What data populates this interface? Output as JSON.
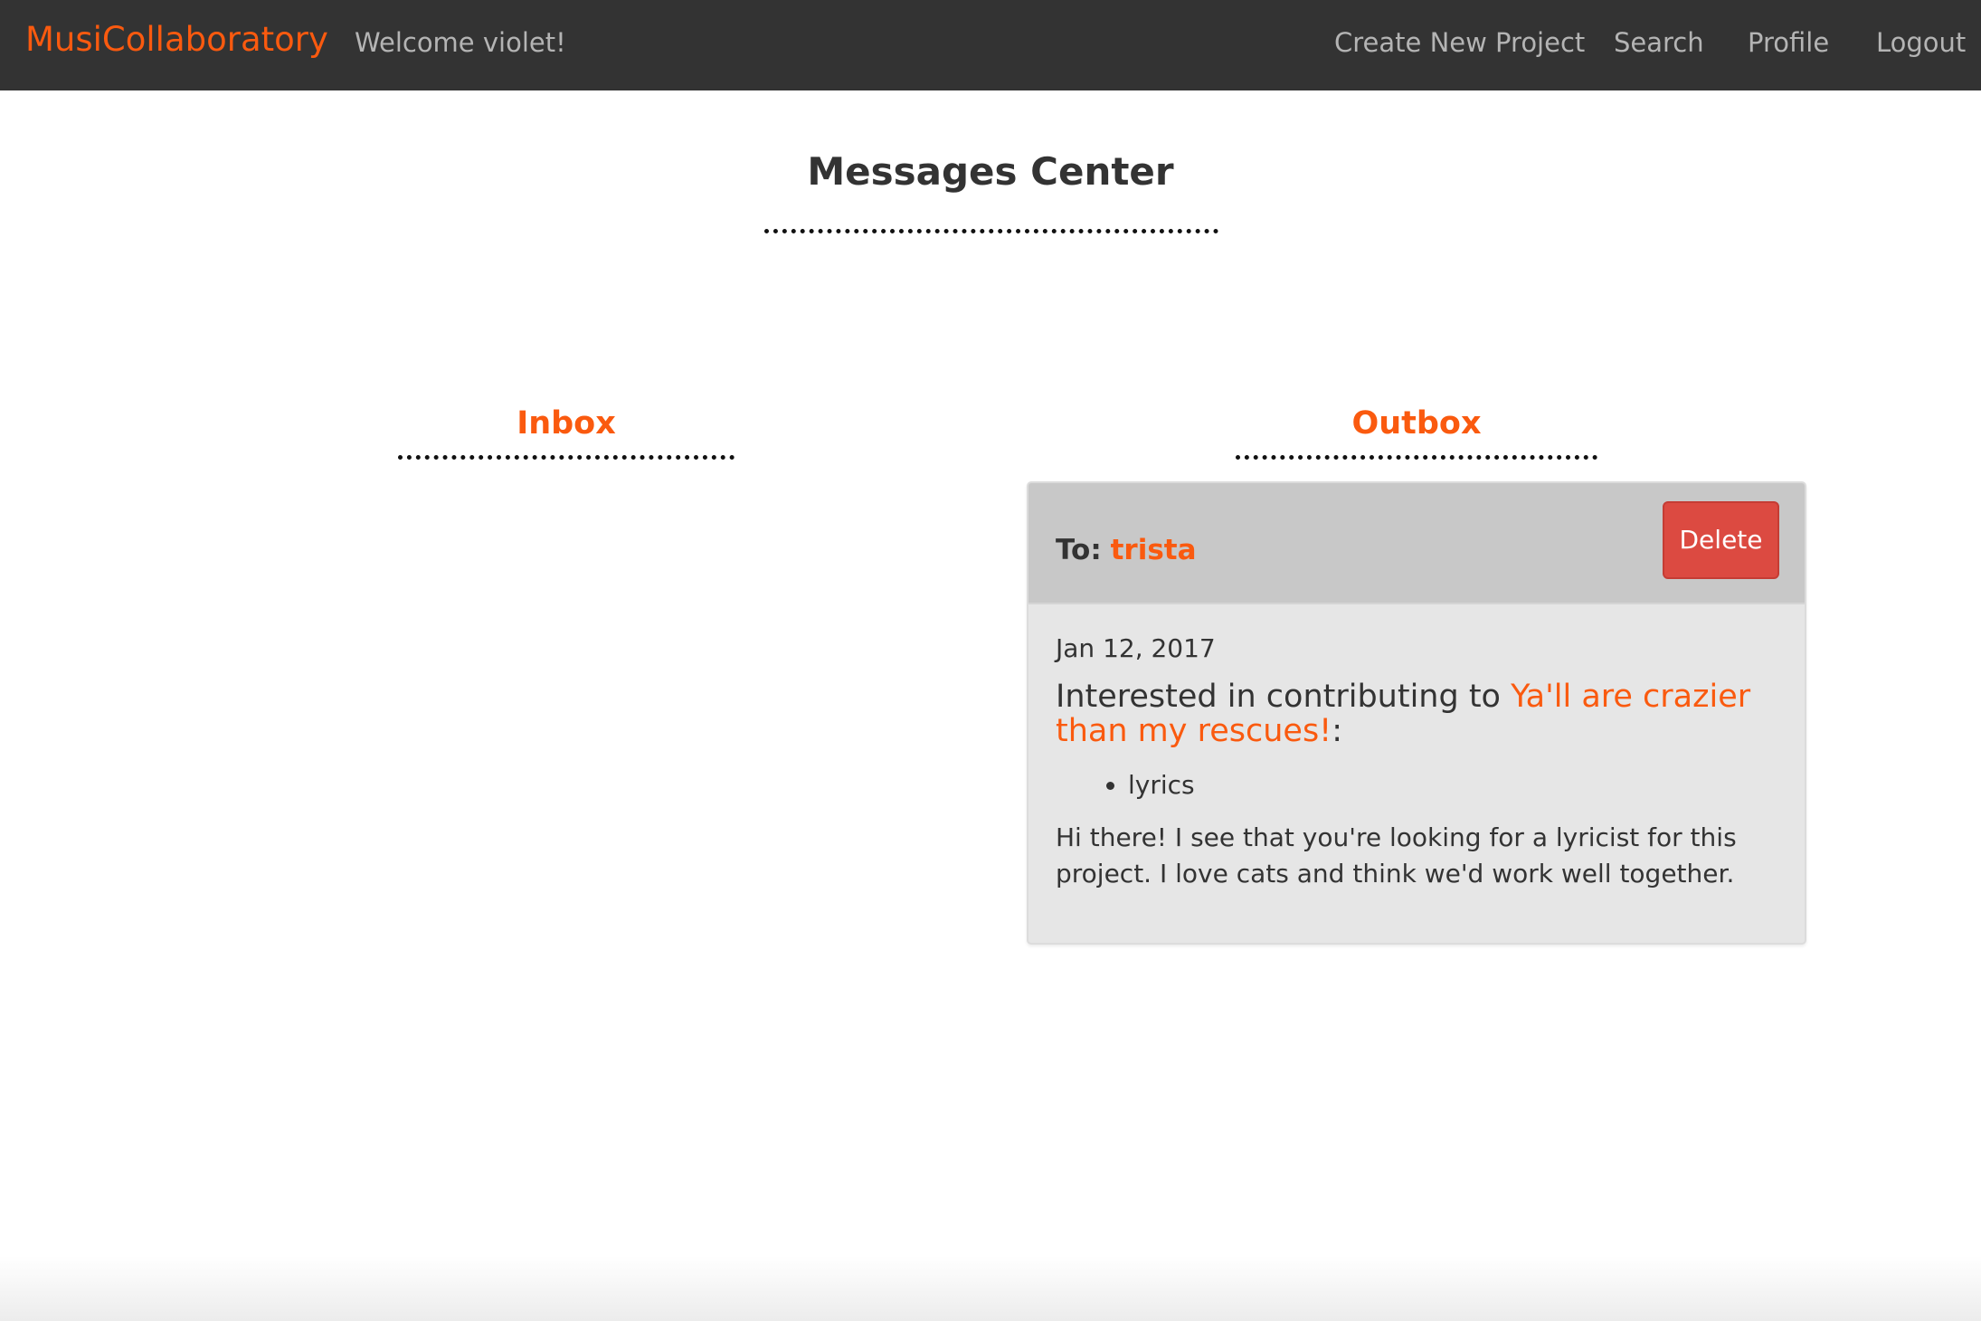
{
  "navbar": {
    "brand": "MusiCollaboratory",
    "welcome": "Welcome violet!",
    "links": {
      "create_project": "Create New Project",
      "search": "Search",
      "profile": "Profile",
      "logout": "Logout"
    }
  },
  "page": {
    "title": "Messages Center"
  },
  "inbox": {
    "heading": "Inbox",
    "messages": []
  },
  "outbox": {
    "heading": "Outbox",
    "messages": [
      {
        "to_label": "To:",
        "to_user": "trista",
        "delete_label": "Delete",
        "date": "Jan 12, 2017",
        "subject_prefix": "Interested in contributing to",
        "project_name": "Ya'll are crazier than my rescues!",
        "subject_suffix": ":",
        "roles": [
          "lyrics"
        ],
        "body": "Hi there! I see that you're looking for a lyricist for this project. I love cats and think we'd work well together."
      }
    ]
  },
  "colors": {
    "navbar_bg": "#333333",
    "accent": "#fa5a0f",
    "nav_text": "#b4b4b4",
    "delete_button": "#dc4a41",
    "card_header": "#c8c8c8",
    "card_body": "#e6e6e6"
  }
}
